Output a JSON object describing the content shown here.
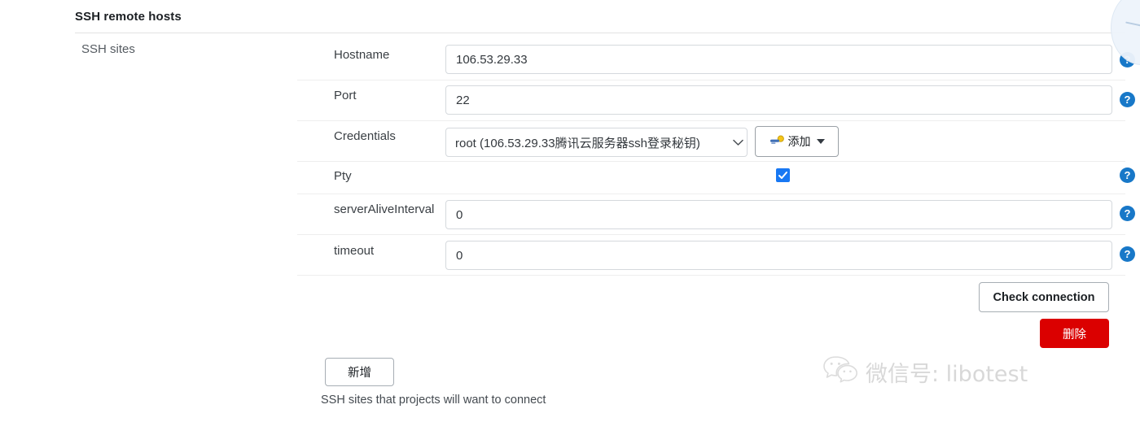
{
  "section": {
    "title": "SSH remote hosts",
    "group_label": "SSH sites"
  },
  "form": {
    "rows": [
      {
        "label": "Hostname",
        "value": "106.53.29.33",
        "type": "text"
      },
      {
        "label": "Port",
        "value": "22",
        "type": "text"
      },
      {
        "label": "Credentials",
        "value": "root (106.53.29.33腾讯云服务器ssh登录秘钥)",
        "type": "select"
      },
      {
        "label": "Pty",
        "value": "",
        "type": "checkbox",
        "checked": true
      },
      {
        "label": "serverAliveInterval",
        "value": "0",
        "type": "text"
      },
      {
        "label": "timeout",
        "value": "0",
        "type": "text"
      }
    ],
    "help_icon_label": "?",
    "help_icon_name": "question-mark-icon",
    "help_icon_color": "#1878c8"
  },
  "add_credential": {
    "label": "添加",
    "icon": "key-icon",
    "caret": "caret-down-icon"
  },
  "actions": {
    "check_connection": "Check connection",
    "delete": "删除",
    "delete_color": "#db0000",
    "add_site": "新增"
  },
  "footer": {
    "hint": "SSH sites that projects will want to connect"
  },
  "watermark": {
    "icon": "wechat-icon",
    "text": "微信号: libotest"
  }
}
